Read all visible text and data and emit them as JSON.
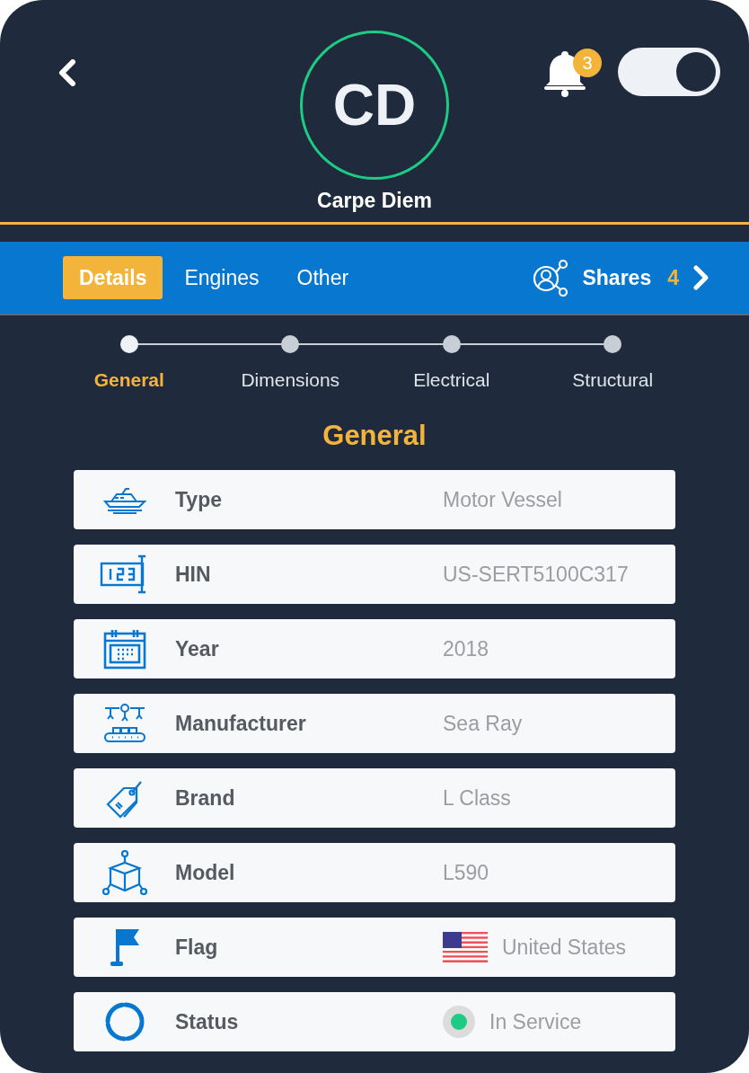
{
  "header": {
    "initials": "CD",
    "vessel_name": "Carpe Diem",
    "notifications": "3",
    "toggle": {
      "on": true
    }
  },
  "tabs": [
    {
      "label": "Details",
      "selected": true
    },
    {
      "label": "Engines",
      "selected": false
    },
    {
      "label": "Other",
      "selected": false
    }
  ],
  "shares": {
    "label": "Shares",
    "count": "4"
  },
  "steps": [
    {
      "label": "General",
      "selected": true
    },
    {
      "label": "Dimensions",
      "selected": false
    },
    {
      "label": "Electrical",
      "selected": false
    },
    {
      "label": "Structural",
      "selected": false
    }
  ],
  "section_title": "General",
  "rows": [
    {
      "kind": "text",
      "label": "Type",
      "value": "Motor Vessel"
    },
    {
      "kind": "text",
      "label": "HIN",
      "value": "US-SERT5100C317"
    },
    {
      "kind": "text",
      "label": "Year",
      "value": "2018"
    },
    {
      "kind": "text",
      "label": "Manufacturer",
      "value": "Sea Ray"
    },
    {
      "kind": "text",
      "label": "Brand",
      "value": "L Class"
    },
    {
      "kind": "text",
      "label": "Model",
      "value": "L590"
    },
    {
      "kind": "flag",
      "label": "Flag",
      "value": "United States"
    },
    {
      "kind": "status",
      "label": "Status",
      "value": "In Service",
      "color": "#1ecb84"
    }
  ]
}
